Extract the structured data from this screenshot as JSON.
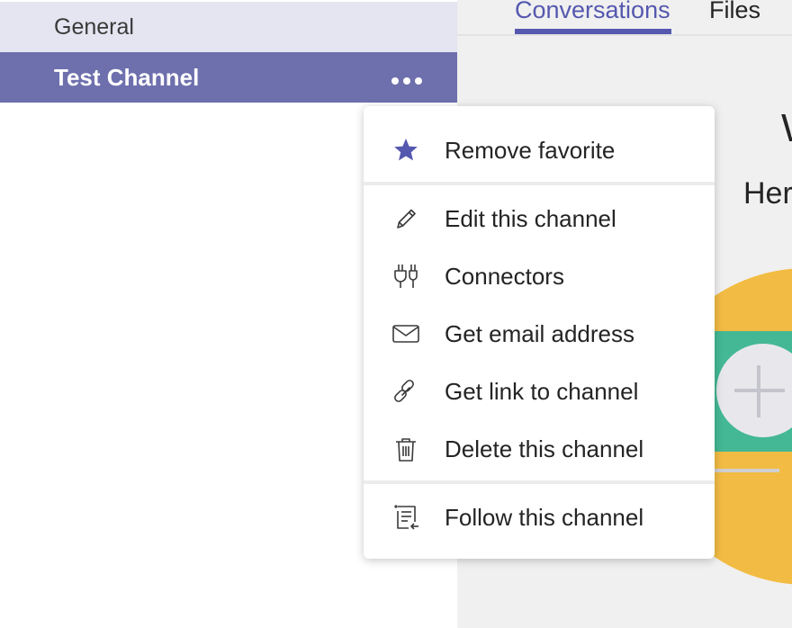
{
  "sidebar": {
    "channels": [
      {
        "label": "General"
      },
      {
        "label": "Test Channel"
      }
    ],
    "more_icon": "more-horizontal-icon"
  },
  "tabs": [
    {
      "label": "Conversations"
    },
    {
      "label": "Files"
    }
  ],
  "welcome": {
    "heading": "W",
    "subtitle": "Her"
  },
  "context_menu": {
    "items": [
      {
        "label": "Remove favorite",
        "icon": "star-icon"
      },
      {
        "label": "Edit this channel",
        "icon": "pencil-icon"
      },
      {
        "label": "Connectors",
        "icon": "connectors-icon"
      },
      {
        "label": "Get email address",
        "icon": "envelope-icon"
      },
      {
        "label": "Get link to channel",
        "icon": "link-icon"
      },
      {
        "label": "Delete this channel",
        "icon": "trash-icon"
      },
      {
        "label": "Follow this channel",
        "icon": "follow-icon"
      }
    ]
  },
  "colors": {
    "accent": "#6e6fad",
    "tab_active": "#5558af",
    "channel_selected_bg": "#e5e5f1",
    "illustration_yellow": "#f2bc44",
    "illustration_green": "#44b894"
  }
}
